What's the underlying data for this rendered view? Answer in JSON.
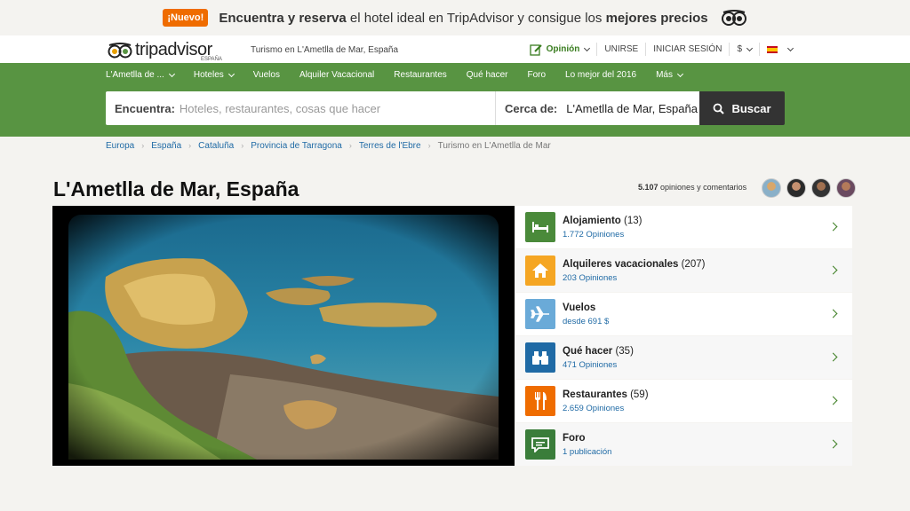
{
  "promo": {
    "badge": "¡Nuevo!",
    "text_bold1": "Encuentra y reserva",
    "text_mid": " el hotel ideal en TripAdvisor y consigue los ",
    "text_bold2": "mejores precios"
  },
  "header": {
    "logo_text": "tripadvisor",
    "logo_sub": "ESPAÑA",
    "tagline": "Turismo en L'Ametlla de Mar, España",
    "review_label": "Opinión",
    "join_label": "UNIRSE",
    "signin_label": "INICIAR SESIÓN",
    "currency_label": "$"
  },
  "nav": {
    "items": [
      "L'Ametlla de ...",
      "Hoteles",
      "Vuelos",
      "Alquiler Vacacional",
      "Restaurantes",
      "Qué hacer",
      "Foro",
      "Lo mejor del 2016",
      "Más"
    ]
  },
  "search": {
    "find_label": "Encuentra:",
    "find_placeholder": "Hoteles, restaurantes, cosas que hacer",
    "near_label": "Cerca de:",
    "near_value": "L'Ametlla de Mar, España",
    "button_label": "Buscar"
  },
  "breadcrumb": [
    "Europa",
    "España",
    "Cataluña",
    "Provincia de Tarragona",
    "Terres de l'Ebre",
    "Turismo en L'Ametlla de Mar"
  ],
  "page": {
    "title": "L'Ametlla de Mar, España",
    "reviews_count": "5.107",
    "reviews_text": " opiniones y comentarios"
  },
  "categories": [
    {
      "name": "Alojamiento",
      "count": " (13)",
      "sub": "1.772 Opiniones",
      "icon": "bed-icon",
      "color": "#4a8a3a"
    },
    {
      "name": "Alquileres vacacionales",
      "count": " (207)",
      "sub": "203 Opiniones",
      "icon": "house-icon",
      "color": "#f5a623"
    },
    {
      "name": "Vuelos",
      "count": "",
      "sub": "desde 691 $",
      "icon": "plane-icon",
      "color": "#6aaad8"
    },
    {
      "name": "Qué hacer",
      "count": " (35)",
      "sub": "471 Opiniones",
      "icon": "binoculars-icon",
      "color": "#1f6aa5"
    },
    {
      "name": "Restaurantes",
      "count": " (59)",
      "sub": "2.659 Opiniones",
      "icon": "fork-knife-icon",
      "color": "#ef6c00"
    },
    {
      "name": "Foro",
      "count": "",
      "sub": "1 publicación",
      "icon": "chat-icon",
      "color": "#3a7d3a"
    }
  ]
}
